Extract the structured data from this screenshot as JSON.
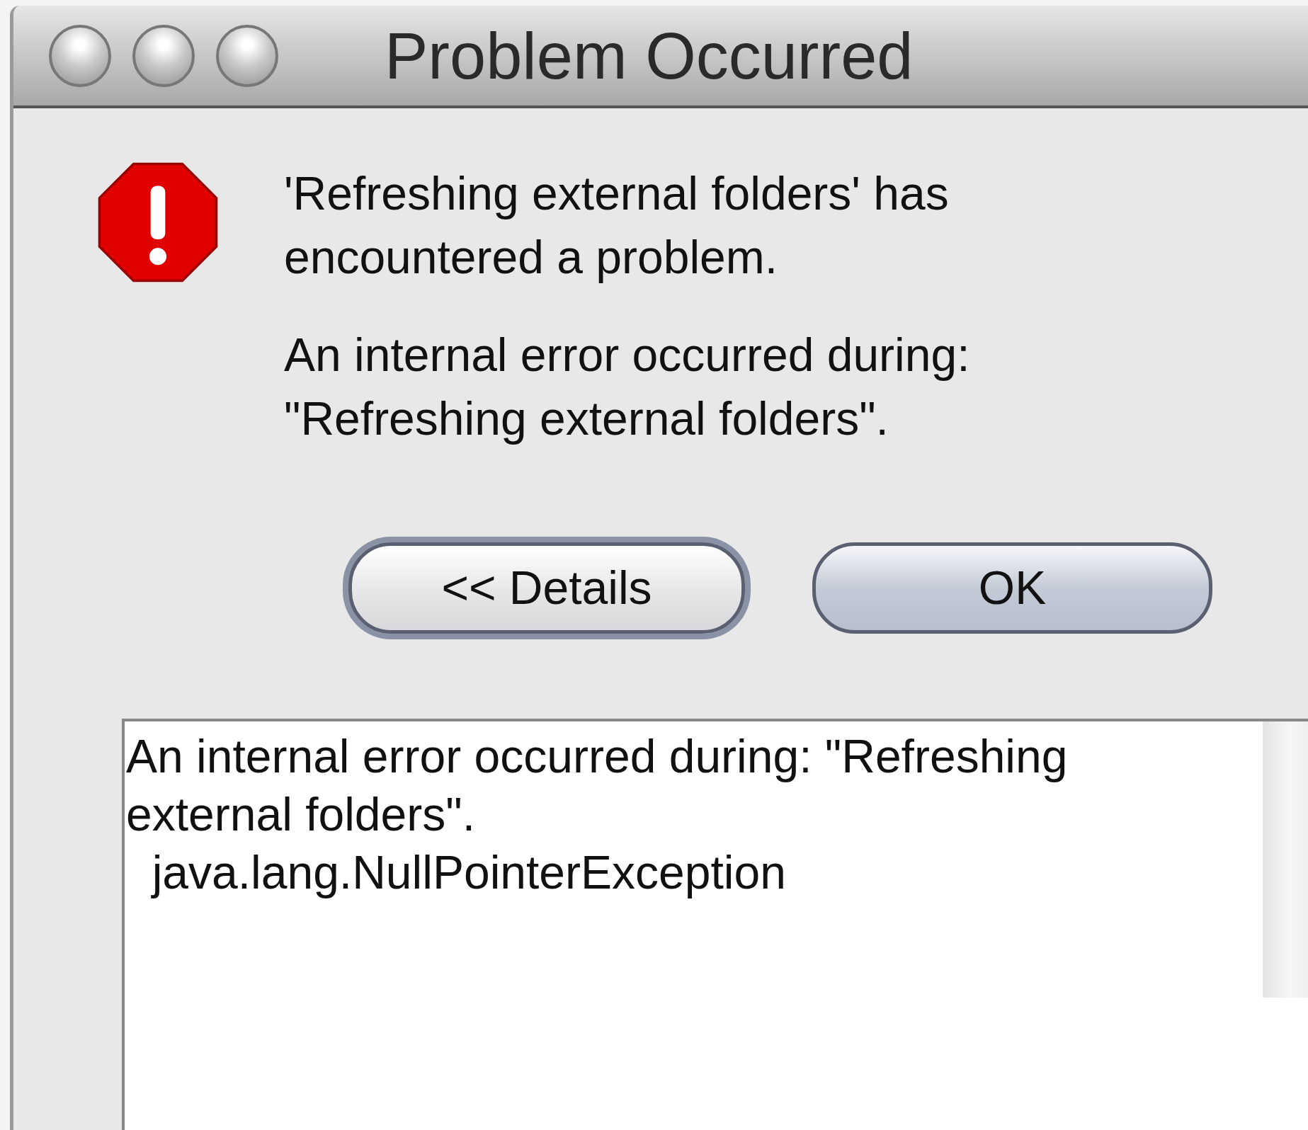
{
  "window": {
    "title": "Problem Occurred"
  },
  "message": {
    "lines": [
      "'Refreshing external folders' has",
      "encountered a problem."
    ]
  },
  "reason": {
    "lines": [
      "An internal error occurred during:",
      "\"Refreshing external folders\"."
    ]
  },
  "buttons": [
    {
      "label": "<< Details",
      "focused": true
    },
    {
      "label": "OK",
      "focused": false
    }
  ],
  "details": {
    "lines": [
      "An internal error occurred during: \"Refreshing",
      "external folders\".",
      "  java.lang.NullPointerException"
    ]
  }
}
